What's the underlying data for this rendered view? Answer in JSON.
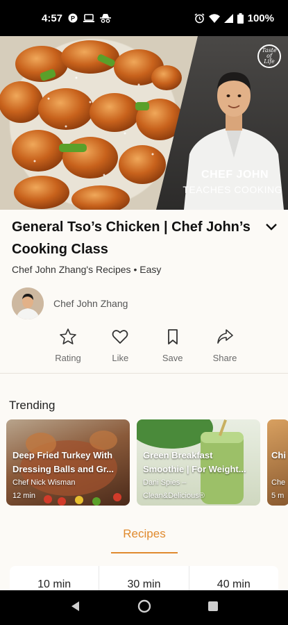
{
  "status_bar": {
    "time": "4:57",
    "battery": "100%"
  },
  "hero": {
    "badge": "Taste of Life",
    "chef_title": "CHEF JOHN",
    "chef_subtitle": "TEACHES COOKING"
  },
  "recipe": {
    "title": "General Tso’s Chicken | Chef John’s Cooking Class",
    "subtitle": "Chef John Zhang's Recipes • Easy",
    "author": "Chef John Zhang"
  },
  "actions": [
    {
      "label": "Rating",
      "icon": "star-icon"
    },
    {
      "label": "Like",
      "icon": "heart-icon"
    },
    {
      "label": "Save",
      "icon": "bookmark-icon"
    },
    {
      "label": "Share",
      "icon": "share-icon"
    }
  ],
  "trending": {
    "label": "Trending",
    "cards": [
      {
        "title_line1": "Deep Fried Turkey With",
        "title_line2": "Dressing Balls and Gr...",
        "author": "Chef Nick Wisman",
        "time": "12 min"
      },
      {
        "title_line1": "Green Breakfast",
        "title_line2": "Smoothie | For Weight...",
        "author": "Dani Spies –",
        "author2": "Clean&Delicious®"
      },
      {
        "title_line1": "Chi",
        "author": "Che",
        "time": "5 m"
      }
    ]
  },
  "tabs": {
    "recipes": "Recipes"
  },
  "times": [
    "10 min",
    "30 min",
    "40 min"
  ]
}
